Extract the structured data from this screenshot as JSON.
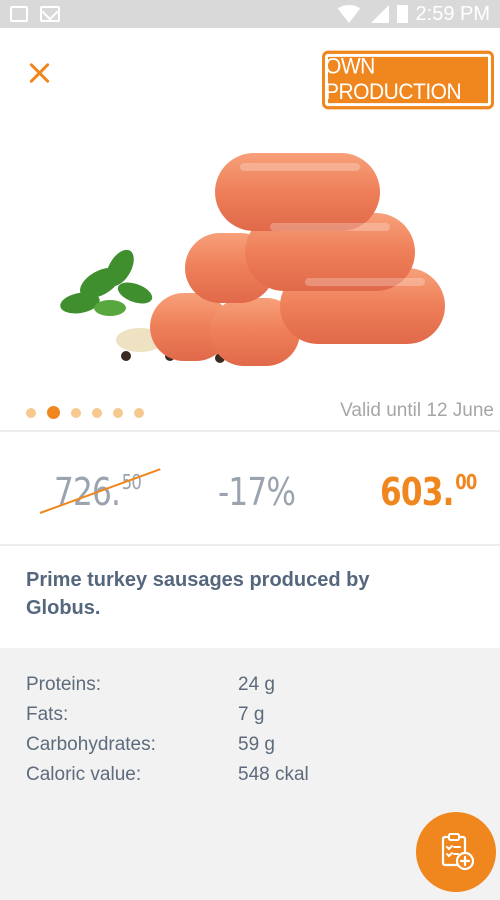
{
  "status_bar": {
    "time": "2:59 PM",
    "icons": [
      "image-icon",
      "mail-icon",
      "wifi-icon",
      "signal-icon",
      "battery-icon"
    ]
  },
  "header": {
    "close_icon": "close-icon",
    "badge": "OWN PRODUCTION"
  },
  "carousel": {
    "image": "sausages-product-image",
    "dot_count": 6,
    "active_index": 1,
    "valid_text": "Valid until 12 June"
  },
  "pricing": {
    "old_price_main": "726.",
    "old_price_cents": "50",
    "discount": "-17%",
    "new_price_main": "603.",
    "new_price_cents": "00"
  },
  "description": "Prime turkey sausages produced by Globus.",
  "nutrition": [
    {
      "label": "Proteins:",
      "value": "24 g"
    },
    {
      "label": "Fats:",
      "value": "7 g"
    },
    {
      "label": "Carbohydrates:",
      "value": "59 g"
    },
    {
      "label": "Caloric value:",
      "value": "548 ckal"
    }
  ],
  "fab": {
    "icon": "add-to-list-icon"
  },
  "colors": {
    "accent": "#f0871e",
    "text_muted": "#9aa3ae",
    "text_dark": "#55677d"
  }
}
